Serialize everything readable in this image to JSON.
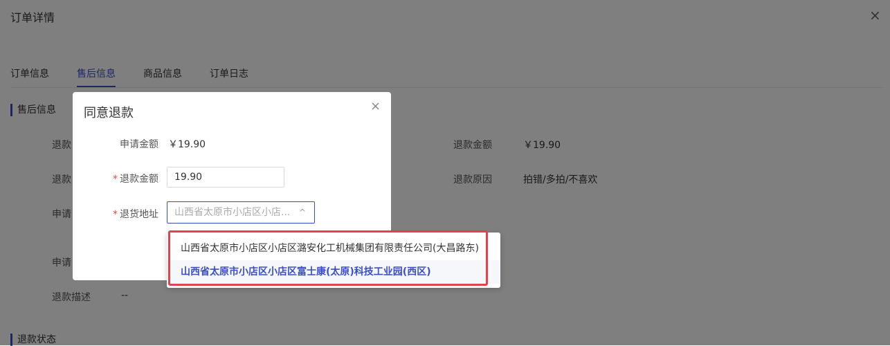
{
  "page": {
    "title": "订单详情",
    "close_icon": "×",
    "tabs": [
      "订单信息",
      "售后信息",
      "商品信息",
      "订单日志"
    ],
    "section_aftersale": "售后信息",
    "section_refund_status": "退款状态",
    "left_fields": [
      "退款",
      "退款",
      "申请",
      "申请",
      "退款描述"
    ],
    "refund_desc_value": "--",
    "refund_amount_label": "退款金额",
    "refund_amount_value": "￥19.90",
    "refund_reason_label": "退款原因",
    "refund_reason_value": "拍错/多拍/不喜欢"
  },
  "modal": {
    "title": "同意退款",
    "close_icon": "×",
    "apply_amount_label": "申请金额",
    "apply_amount_value": "￥19.90",
    "refund_amount_label": "退款金额",
    "refund_amount_required": "*",
    "refund_amount_value": "19.90",
    "return_address_label": "退货地址",
    "return_address_required": "*",
    "return_address_placeholder": "山西省太原市小店区小店...",
    "chevron": "^"
  },
  "dropdown": {
    "options": [
      {
        "label": "山西省太原市小店区小店区潞安化工机械集团有限责任公司(大昌路东)",
        "selected": false
      },
      {
        "label": "山西省太原市小店区小店区富士康(太原)科技工业园(西区)",
        "selected": true
      }
    ]
  },
  "colors": {
    "accent": "#3a4fc4",
    "highlight_border": "#e2424c",
    "required": "#e54d42"
  }
}
